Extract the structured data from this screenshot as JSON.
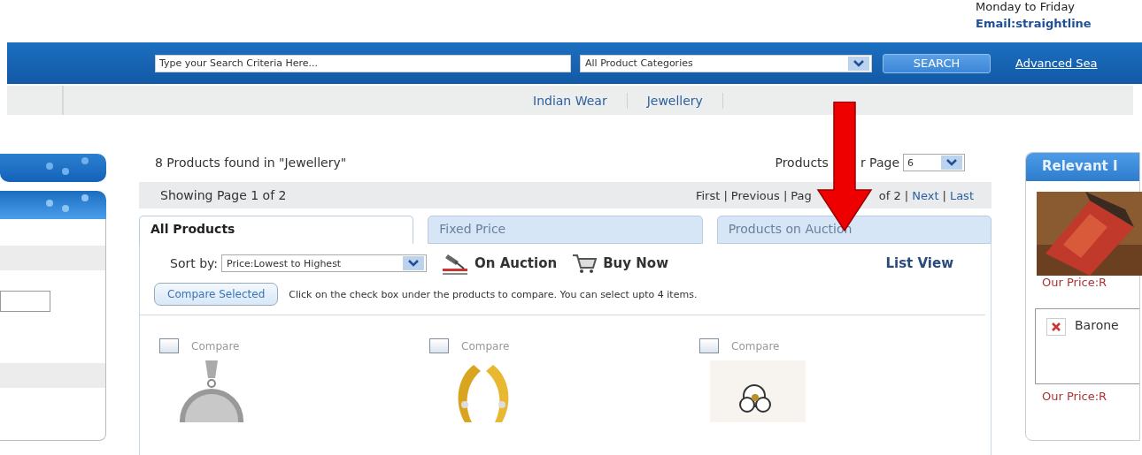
{
  "header": {
    "hours": "Monday to Friday",
    "email": "Email:straightline"
  },
  "search": {
    "placeholder": "Type your Search Criteria Here...",
    "category": "All Product Categories",
    "button": "SEARCH",
    "advanced": "Advanced Sea"
  },
  "nav": [
    {
      "label": "Indian Wear"
    },
    {
      "label": "Jewellery"
    }
  ],
  "results": {
    "found": "8 Products found in \"Jewellery\"",
    "per_page_label": "Products",
    "per_page_label_2": "r Page",
    "per_page": "6"
  },
  "paging": {
    "showing": "Showing Page 1 of 2",
    "items": [
      {
        "label": "First |",
        "kind": "text"
      },
      {
        "label": "Previous |",
        "kind": "text"
      },
      {
        "label": "Pag",
        "kind": "covered"
      },
      {
        "label": "of 2 |",
        "kind": "text"
      },
      {
        "label": "Next",
        "kind": "link"
      },
      {
        "label": "|",
        "kind": "text"
      },
      {
        "label": "Last",
        "kind": "link"
      }
    ]
  },
  "tabs": [
    {
      "label": "All Products",
      "selected": true
    },
    {
      "label": "Fixed Price",
      "selected": false
    },
    {
      "label": "Products on Auction",
      "selected": false
    }
  ],
  "sort": {
    "label": "Sort by:",
    "value": "Price:Lowest to Highest"
  },
  "legend": [
    {
      "label": "On Auction",
      "kind": "auction"
    },
    {
      "label": "Buy Now",
      "kind": "cart"
    }
  ],
  "list_view": "List View",
  "compare": {
    "button": "Compare Selected",
    "hint": "Click on the check box under the products to compare. You can select upto 4 items."
  },
  "products": [
    {
      "compare": "Compare",
      "checked": false,
      "kind": "pendant"
    },
    {
      "compare": "Compare",
      "checked": false,
      "kind": "earring"
    },
    {
      "compare": "Compare",
      "checked": false,
      "kind": "flower"
    }
  ],
  "sidebar": {
    "title": "Relevant I",
    "items": [
      {
        "kind": "picture",
        "price": "Our Price:R"
      },
      {
        "kind": "broken",
        "name": "Barone",
        "price": "Our Price:R"
      }
    ]
  }
}
